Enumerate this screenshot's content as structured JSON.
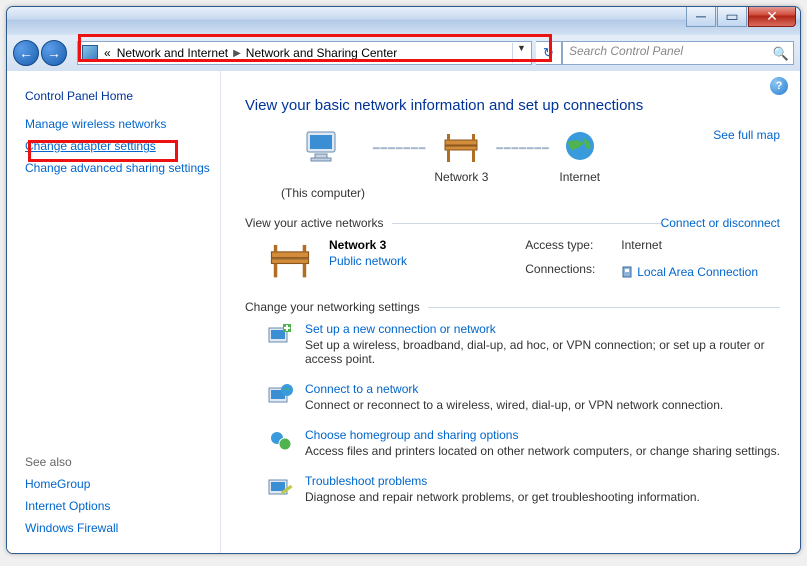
{
  "titlebar": {
    "min": "─",
    "max": "▭",
    "close": "✕"
  },
  "nav": {
    "back": "←",
    "forward": "→",
    "chev": "«",
    "bc1": "Network and Internet",
    "bc2": "Network and Sharing Center",
    "dropdown": "▼",
    "refresh": "↻"
  },
  "search": {
    "placeholder": "Search Control Panel",
    "icon": "🔍"
  },
  "sidebar": {
    "home": "Control Panel Home",
    "links": [
      "Manage wireless networks",
      "Change adapter settings",
      "Change advanced sharing settings"
    ],
    "see_also_label": "See also",
    "see_also": [
      "HomeGroup",
      "Internet Options",
      "Windows Firewall"
    ]
  },
  "main": {
    "help": "?",
    "title": "View your basic network information and set up connections",
    "see_full_map": "See full map",
    "map": {
      "pc": "(This computer)",
      "net": "Network 3",
      "internet": "Internet"
    },
    "active_heading": "View your active networks",
    "connect_disconnect": "Connect or disconnect",
    "network": {
      "name": "Network 3",
      "type": "Public network",
      "access_label": "Access type:",
      "access_value": "Internet",
      "conn_label": "Connections:",
      "conn_value": "Local Area Connection"
    },
    "change_heading": "Change your networking settings",
    "settings": [
      {
        "link": "Set up a new connection or network",
        "desc": "Set up a wireless, broadband, dial-up, ad hoc, or VPN connection; or set up a router or access point."
      },
      {
        "link": "Connect to a network",
        "desc": "Connect or reconnect to a wireless, wired, dial-up, or VPN network connection."
      },
      {
        "link": "Choose homegroup and sharing options",
        "desc": "Access files and printers located on other network computers, or change sharing settings."
      },
      {
        "link": "Troubleshoot problems",
        "desc": "Diagnose and repair network problems, or get troubleshooting information."
      }
    ]
  }
}
